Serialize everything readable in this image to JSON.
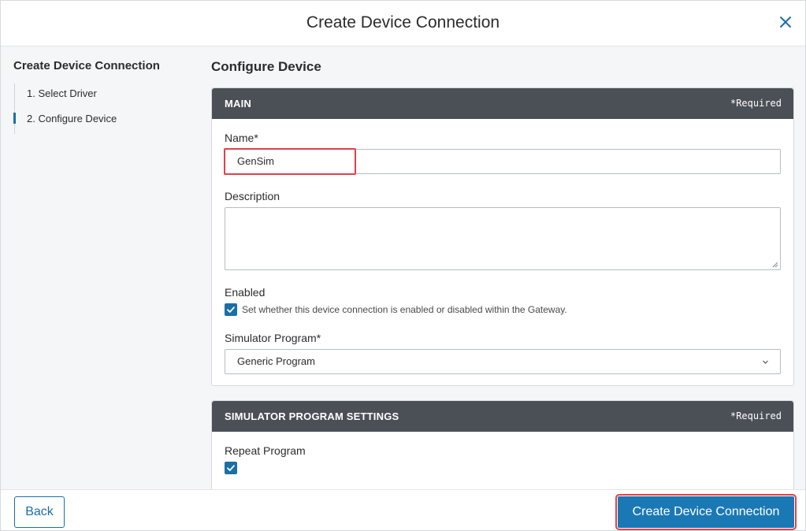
{
  "dialog": {
    "title": "Create Device Connection"
  },
  "sidebar": {
    "title": "Create Device Connection",
    "steps": [
      {
        "label": "1. Select Driver",
        "active": false
      },
      {
        "label": "2. Configure Device",
        "active": true
      }
    ]
  },
  "content": {
    "title": "Configure Device"
  },
  "main_section": {
    "title": "MAIN",
    "required_note": "*Required",
    "name_label": "Name*",
    "name_value": "GenSim",
    "description_label": "Description",
    "description_value": "",
    "enabled_label": "Enabled",
    "enabled_checked": true,
    "enabled_description": "Set whether this device connection is enabled or disabled within the Gateway.",
    "program_label": "Simulator Program*",
    "program_value": "Generic Program"
  },
  "sim_section": {
    "title": "SIMULATOR PROGRAM SETTINGS",
    "required_note": "*Required",
    "repeat_label": "Repeat Program",
    "repeat_checked": true
  },
  "footer": {
    "back_label": "Back",
    "create_label": "Create Device Connection"
  },
  "colors": {
    "accent": "#1a79b5",
    "section_header": "#4b5057",
    "highlight": "#e0404a"
  },
  "icons": {
    "close": "close-icon",
    "check": "checkmark-icon",
    "dropdown": "chevron-down-icon"
  }
}
